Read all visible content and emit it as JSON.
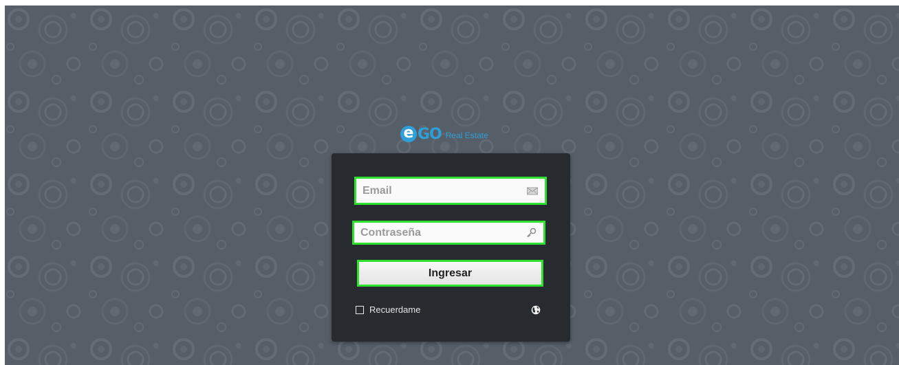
{
  "brand": {
    "logo_e": "e",
    "logo_go": "GO",
    "logo_sub": "Real Estate",
    "color": "#2f9fd8"
  },
  "login": {
    "email": {
      "placeholder": "Email",
      "value": "",
      "icon": "envelope-icon"
    },
    "password": {
      "placeholder": "Contraseña",
      "value": "",
      "icon": "key-icon"
    },
    "submit_label": "Ingresar",
    "remember_label": "Recuerdame",
    "remember_checked": false,
    "language_icon": "globe-icon"
  },
  "colors": {
    "background": "#565e68",
    "panel": "#272b30",
    "highlight": "#2ee12e"
  }
}
